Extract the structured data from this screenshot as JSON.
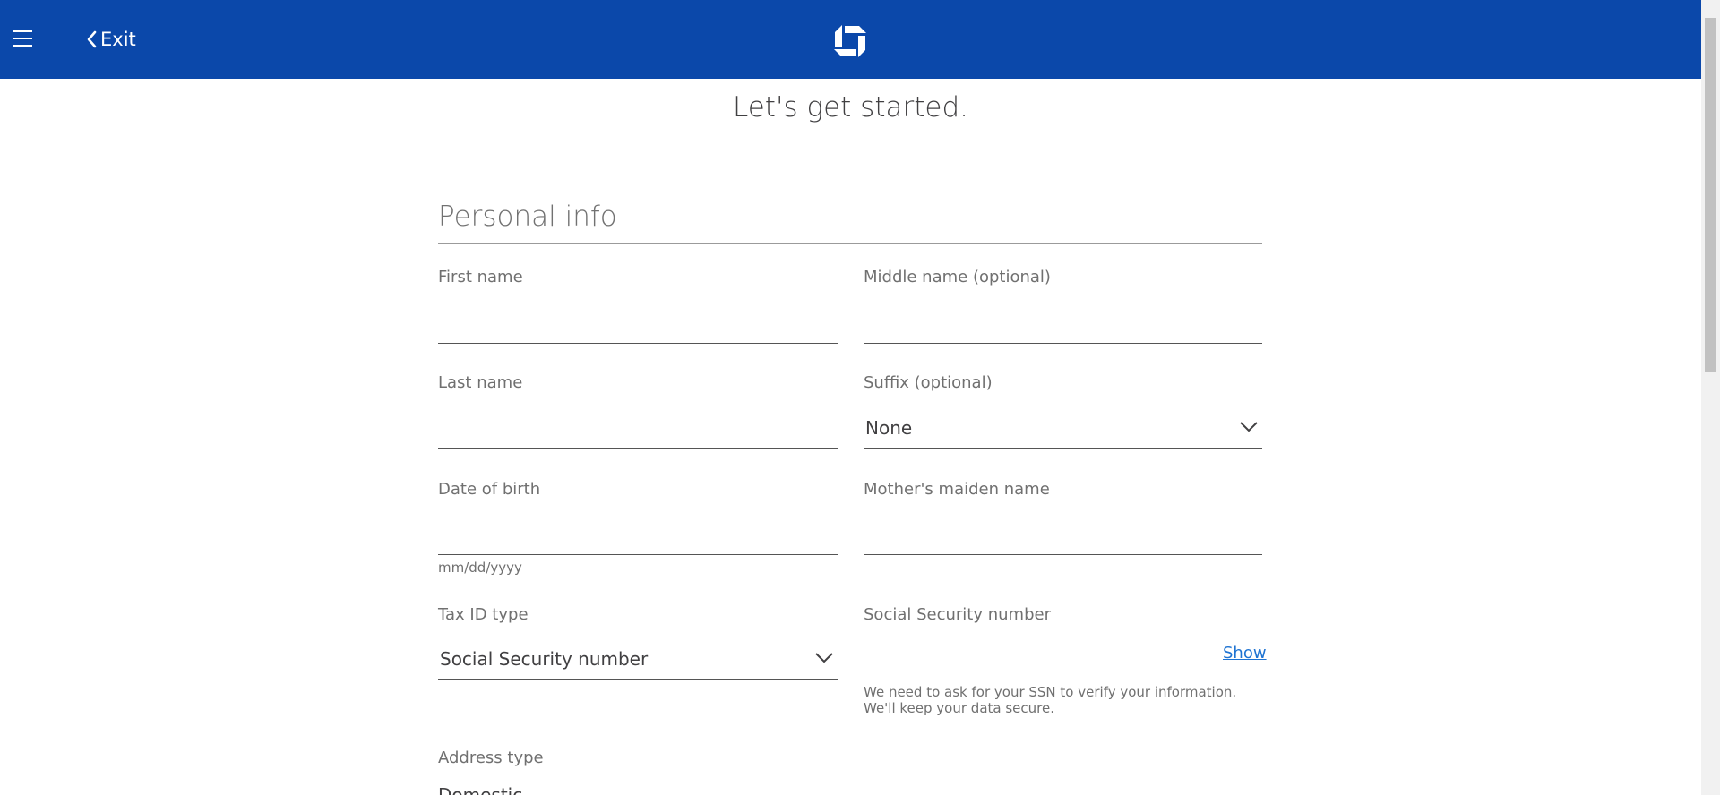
{
  "header": {
    "exit_label": "Exit",
    "brand_color": "#0b48aa"
  },
  "page": {
    "heading": "Let's get started."
  },
  "personal_info": {
    "title": "Personal info",
    "first_name": {
      "label": "First name",
      "value": ""
    },
    "middle_name": {
      "label": "Middle name (optional)",
      "value": ""
    },
    "last_name": {
      "label": "Last name",
      "value": ""
    },
    "suffix": {
      "label": "Suffix (optional)",
      "selected": "None"
    },
    "dob": {
      "label": "Date of birth",
      "value": "",
      "hint": "mm/dd/yyyy"
    },
    "maiden_name": {
      "label": "Mother's maiden name",
      "value": ""
    },
    "tax_id_type": {
      "label": "Tax ID type",
      "selected": "Social Security number"
    },
    "ssn": {
      "label": "Social Security number",
      "value": "",
      "show_label": "Show",
      "hint": "We need to ask for your SSN to verify your information. We'll keep your data secure."
    },
    "address_type": {
      "label": "Address type",
      "selected": "Domestic"
    }
  }
}
